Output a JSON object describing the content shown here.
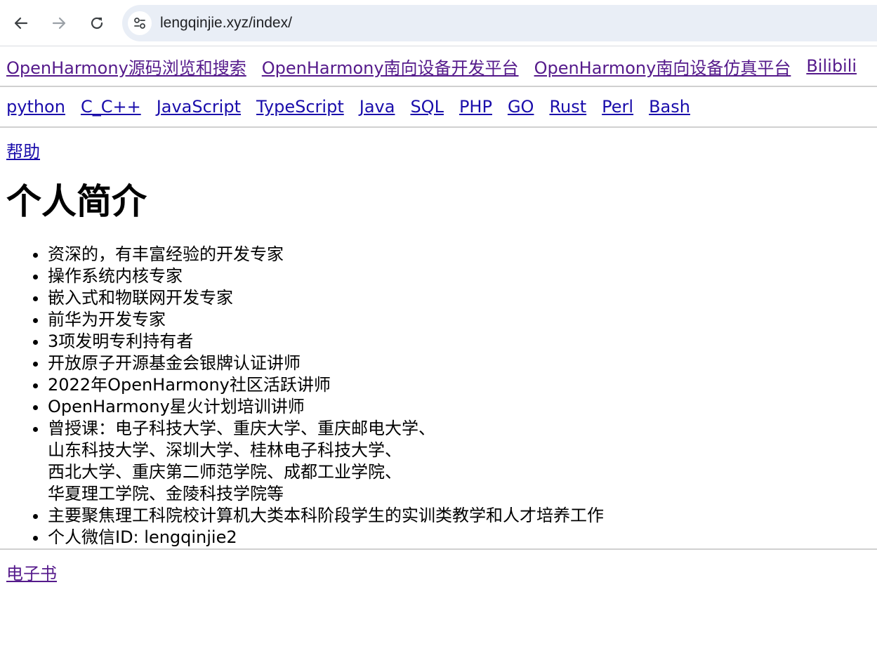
{
  "browser": {
    "url": "lengqinjie.xyz/index/",
    "back_icon": "arrow-left-icon",
    "forward_icon": "arrow-right-icon",
    "reload_icon": "reload-icon",
    "site_info_icon": "site-settings-icon"
  },
  "nav_row1": [
    {
      "label": "OpenHarmony源码浏览和搜索 "
    },
    {
      "label": "OpenHarmony南向设备开发平台 "
    },
    {
      "label": "OpenHarmony南向设备仿真平台 "
    },
    {
      "label": "Bilibili "
    }
  ],
  "nav_row2": [
    {
      "label": "python"
    },
    {
      "label": "C_C++"
    },
    {
      "label": "JavaScript"
    },
    {
      "label": "TypeScript"
    },
    {
      "label": "Java"
    },
    {
      "label": "SQL"
    },
    {
      "label": "PHP"
    },
    {
      "label": "GO"
    },
    {
      "label": "Rust"
    },
    {
      "label": "Perl"
    },
    {
      "label": "Bash"
    }
  ],
  "help_link": "帮助",
  "title": "个人简介",
  "profile": [
    {
      "lines": [
        "资深的，有丰富经验的开发专家"
      ]
    },
    {
      "lines": [
        "操作系统内核专家"
      ]
    },
    {
      "lines": [
        "嵌入式和物联网开发专家"
      ]
    },
    {
      "lines": [
        "前华为开发专家"
      ]
    },
    {
      "lines": [
        "3项发明专利持有者"
      ]
    },
    {
      "lines": [
        "开放原子开源基金会银牌认证讲师"
      ]
    },
    {
      "lines": [
        "2022年OpenHarmony社区活跃讲师"
      ]
    },
    {
      "lines": [
        "OpenHarmony星火计划培训讲师"
      ]
    },
    {
      "lines": [
        "曾授课：电子科技大学、重庆大学、重庆邮电大学、",
        "山东科技大学、深圳大学、桂林电子科技大学、",
        "西北大学、重庆第二师范学院、成都工业学院、",
        "华夏理工学院、金陵科技学院等"
      ]
    },
    {
      "lines": [
        "主要聚焦理工科院校计算机大类本科阶段学生的实训类教学和人才培养工作"
      ]
    },
    {
      "lines": [
        "个人微信ID: lengqinjie2"
      ]
    }
  ],
  "ebook_link": "电子书"
}
